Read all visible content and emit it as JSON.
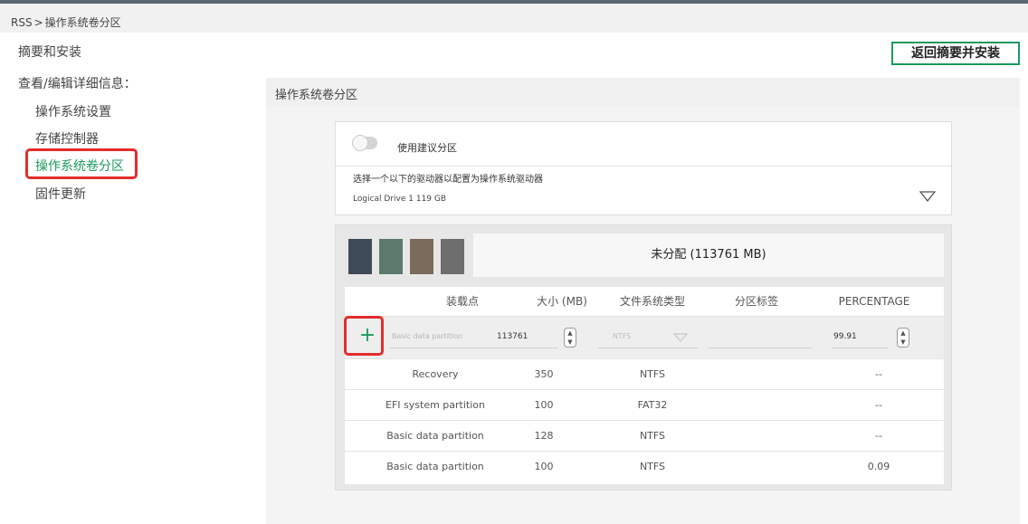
{
  "breadcrumb": {
    "root": "RSS",
    "separator": ">",
    "current": "操作系统卷分区"
  },
  "left": {
    "summary_title": "摘要和安装",
    "details_label": "查看/编辑详细信息：",
    "nav": [
      {
        "label": "操作系统设置",
        "active": false
      },
      {
        "label": "存储控制器",
        "active": false
      },
      {
        "label": "操作系统卷分区",
        "active": true
      },
      {
        "label": "固件更新",
        "active": false
      }
    ]
  },
  "header": {
    "return_button": "返回摘要并安装"
  },
  "section": {
    "title": "操作系统卷分区"
  },
  "drive": {
    "toggle_label": "使用建议分区",
    "toggle_on": false,
    "instruction": "选择一个以下的驱动器以配置为操作系统驱动器",
    "selected": "Logical Drive 1 119 GB"
  },
  "partition": {
    "swatch_colors": [
      "#3f4a58",
      "#5b7a6c",
      "#7a6b5b",
      "#6e6e6e"
    ],
    "unallocated": "未分配 (113761 MB)",
    "accent_color": "#1b9a5e",
    "columns": [
      "装载点",
      "大小 (MB)",
      "文件系统类型",
      "分区标签",
      "PERCENTAGE"
    ],
    "edit": {
      "mount_placeholder": "Basic data partition",
      "size_value": "113761",
      "fs_placeholder": "NTFS",
      "label_value": "",
      "percent_value": "99.91"
    },
    "rows": [
      {
        "mount": "Recovery",
        "size": "350",
        "fs": "NTFS",
        "label": "",
        "percent": "--"
      },
      {
        "mount": "EFI system partition",
        "size": "100",
        "fs": "FAT32",
        "label": "",
        "percent": "--"
      },
      {
        "mount": "Basic data partition",
        "size": "128",
        "fs": "NTFS",
        "label": "",
        "percent": "--"
      },
      {
        "mount": "Basic data partition",
        "size": "100",
        "fs": "NTFS",
        "label": "",
        "percent": "0.09"
      }
    ]
  }
}
